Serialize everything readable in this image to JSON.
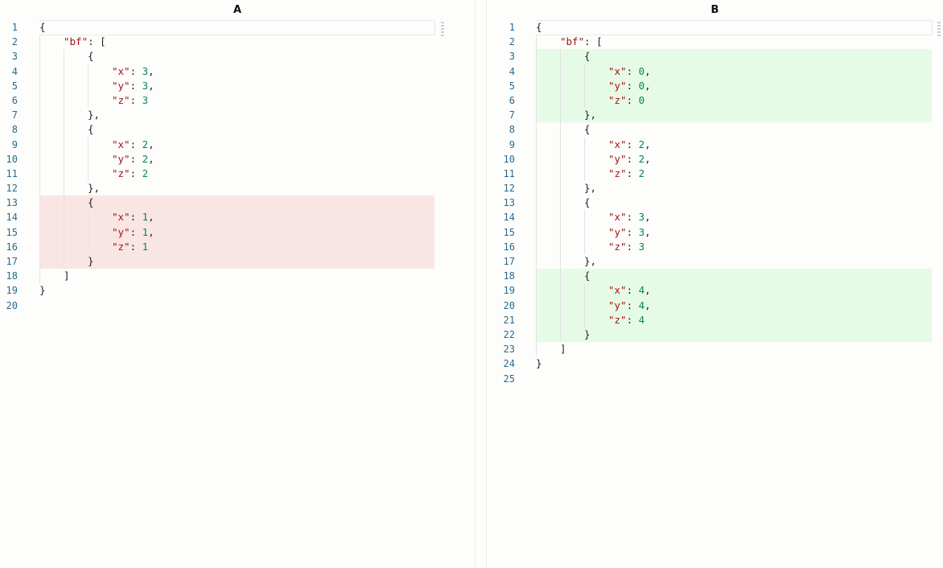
{
  "panes": [
    {
      "title": "A",
      "lines": [
        {
          "num": "1",
          "type": "normal",
          "indent": 0,
          "parts": [
            {
              "t": "{",
              "c": "p"
            }
          ]
        },
        {
          "num": "2",
          "type": "normal",
          "indent": 1,
          "parts": [
            {
              "t": "\"bf\"",
              "c": "key"
            },
            {
              "t": ": [",
              "c": "p"
            }
          ]
        },
        {
          "num": "3",
          "type": "normal",
          "indent": 2,
          "parts": [
            {
              "t": "{",
              "c": "p"
            }
          ]
        },
        {
          "num": "4",
          "type": "normal",
          "indent": 3,
          "parts": [
            {
              "t": "\"x\"",
              "c": "key"
            },
            {
              "t": ": ",
              "c": "p"
            },
            {
              "t": "3",
              "c": "num"
            },
            {
              "t": ",",
              "c": "p"
            }
          ]
        },
        {
          "num": "5",
          "type": "normal",
          "indent": 3,
          "parts": [
            {
              "t": "\"y\"",
              "c": "key"
            },
            {
              "t": ": ",
              "c": "p"
            },
            {
              "t": "3",
              "c": "num"
            },
            {
              "t": ",",
              "c": "p"
            }
          ]
        },
        {
          "num": "6",
          "type": "normal",
          "indent": 3,
          "parts": [
            {
              "t": "\"z\"",
              "c": "key"
            },
            {
              "t": ": ",
              "c": "p"
            },
            {
              "t": "3",
              "c": "num"
            }
          ]
        },
        {
          "num": "7",
          "type": "normal",
          "indent": 2,
          "parts": [
            {
              "t": "},",
              "c": "p"
            }
          ]
        },
        {
          "num": "8",
          "type": "normal",
          "indent": 2,
          "parts": [
            {
              "t": "{",
              "c": "p"
            }
          ]
        },
        {
          "num": "9",
          "type": "normal",
          "indent": 3,
          "parts": [
            {
              "t": "\"x\"",
              "c": "key"
            },
            {
              "t": ": ",
              "c": "p"
            },
            {
              "t": "2",
              "c": "num"
            },
            {
              "t": ",",
              "c": "p"
            }
          ]
        },
        {
          "num": "10",
          "type": "normal",
          "indent": 3,
          "parts": [
            {
              "t": "\"y\"",
              "c": "key"
            },
            {
              "t": ": ",
              "c": "p"
            },
            {
              "t": "2",
              "c": "num"
            },
            {
              "t": ",",
              "c": "p"
            }
          ]
        },
        {
          "num": "11",
          "type": "normal",
          "indent": 3,
          "parts": [
            {
              "t": "\"z\"",
              "c": "key"
            },
            {
              "t": ": ",
              "c": "p"
            },
            {
              "t": "2",
              "c": "num"
            }
          ]
        },
        {
          "num": "12",
          "type": "normal",
          "indent": 2,
          "parts": [
            {
              "t": "},",
              "c": "p"
            }
          ]
        },
        {
          "num": "13",
          "type": "removed",
          "indent": 2,
          "parts": [
            {
              "t": "{",
              "c": "p"
            }
          ]
        },
        {
          "num": "14",
          "type": "removed",
          "indent": 3,
          "parts": [
            {
              "t": "\"x\"",
              "c": "key"
            },
            {
              "t": ": ",
              "c": "p"
            },
            {
              "t": "1",
              "c": "num"
            },
            {
              "t": ",",
              "c": "p"
            }
          ]
        },
        {
          "num": "15",
          "type": "removed",
          "indent": 3,
          "parts": [
            {
              "t": "\"y\"",
              "c": "key"
            },
            {
              "t": ": ",
              "c": "p"
            },
            {
              "t": "1",
              "c": "num"
            },
            {
              "t": ",",
              "c": "p"
            }
          ]
        },
        {
          "num": "16",
          "type": "removed",
          "indent": 3,
          "parts": [
            {
              "t": "\"z\"",
              "c": "key"
            },
            {
              "t": ": ",
              "c": "p"
            },
            {
              "t": "1",
              "c": "num"
            }
          ]
        },
        {
          "num": "17",
          "type": "removed",
          "indent": 2,
          "parts": [
            {
              "t": "}",
              "c": "p"
            }
          ]
        },
        {
          "num": "18",
          "type": "normal",
          "indent": 1,
          "parts": [
            {
              "t": "]",
              "c": "p"
            }
          ]
        },
        {
          "num": "19",
          "type": "normal",
          "indent": 0,
          "parts": [
            {
              "t": "}",
              "c": "p"
            }
          ]
        },
        {
          "num": "20",
          "type": "normal",
          "indent": 0,
          "parts": []
        }
      ]
    },
    {
      "title": "B",
      "lines": [
        {
          "num": "1",
          "type": "normal",
          "indent": 0,
          "parts": [
            {
              "t": "{",
              "c": "p"
            }
          ]
        },
        {
          "num": "2",
          "type": "normal",
          "indent": 1,
          "parts": [
            {
              "t": "\"bf\"",
              "c": "key"
            },
            {
              "t": ": [",
              "c": "p"
            }
          ]
        },
        {
          "num": "3",
          "type": "added",
          "indent": 2,
          "parts": [
            {
              "t": "{",
              "c": "p"
            }
          ]
        },
        {
          "num": "4",
          "type": "added",
          "indent": 3,
          "parts": [
            {
              "t": "\"x\"",
              "c": "key"
            },
            {
              "t": ": ",
              "c": "p"
            },
            {
              "t": "0",
              "c": "num"
            },
            {
              "t": ",",
              "c": "p"
            }
          ]
        },
        {
          "num": "5",
          "type": "added",
          "indent": 3,
          "parts": [
            {
              "t": "\"y\"",
              "c": "key"
            },
            {
              "t": ": ",
              "c": "p"
            },
            {
              "t": "0",
              "c": "num"
            },
            {
              "t": ",",
              "c": "p"
            }
          ]
        },
        {
          "num": "6",
          "type": "added",
          "indent": 3,
          "parts": [
            {
              "t": "\"z\"",
              "c": "key"
            },
            {
              "t": ": ",
              "c": "p"
            },
            {
              "t": "0",
              "c": "num"
            }
          ]
        },
        {
          "num": "7",
          "type": "added",
          "indent": 2,
          "parts": [
            {
              "t": "},",
              "c": "p"
            }
          ]
        },
        {
          "num": "8",
          "type": "normal",
          "indent": 2,
          "parts": [
            {
              "t": "{",
              "c": "p"
            }
          ]
        },
        {
          "num": "9",
          "type": "normal",
          "indent": 3,
          "parts": [
            {
              "t": "\"x\"",
              "c": "key"
            },
            {
              "t": ": ",
              "c": "p"
            },
            {
              "t": "2",
              "c": "num"
            },
            {
              "t": ",",
              "c": "p"
            }
          ]
        },
        {
          "num": "10",
          "type": "normal",
          "indent": 3,
          "parts": [
            {
              "t": "\"y\"",
              "c": "key"
            },
            {
              "t": ": ",
              "c": "p"
            },
            {
              "t": "2",
              "c": "num"
            },
            {
              "t": ",",
              "c": "p"
            }
          ]
        },
        {
          "num": "11",
          "type": "normal",
          "indent": 3,
          "parts": [
            {
              "t": "\"z\"",
              "c": "key"
            },
            {
              "t": ": ",
              "c": "p"
            },
            {
              "t": "2",
              "c": "num"
            }
          ]
        },
        {
          "num": "12",
          "type": "normal",
          "indent": 2,
          "parts": [
            {
              "t": "},",
              "c": "p"
            }
          ]
        },
        {
          "num": "13",
          "type": "normal",
          "indent": 2,
          "parts": [
            {
              "t": "{",
              "c": "p"
            }
          ]
        },
        {
          "num": "14",
          "type": "normal",
          "indent": 3,
          "parts": [
            {
              "t": "\"x\"",
              "c": "key"
            },
            {
              "t": ": ",
              "c": "p"
            },
            {
              "t": "3",
              "c": "num"
            },
            {
              "t": ",",
              "c": "p"
            }
          ]
        },
        {
          "num": "15",
          "type": "normal",
          "indent": 3,
          "parts": [
            {
              "t": "\"y\"",
              "c": "key"
            },
            {
              "t": ": ",
              "c": "p"
            },
            {
              "t": "3",
              "c": "num"
            },
            {
              "t": ",",
              "c": "p"
            }
          ]
        },
        {
          "num": "16",
          "type": "normal",
          "indent": 3,
          "parts": [
            {
              "t": "\"z\"",
              "c": "key"
            },
            {
              "t": ": ",
              "c": "p"
            },
            {
              "t": "3",
              "c": "num"
            }
          ]
        },
        {
          "num": "17",
          "type": "normal",
          "indent": 2,
          "parts": [
            {
              "t": "},",
              "c": "p"
            }
          ]
        },
        {
          "num": "18",
          "type": "added",
          "indent": 2,
          "parts": [
            {
              "t": "{",
              "c": "p"
            }
          ]
        },
        {
          "num": "19",
          "type": "added",
          "indent": 3,
          "parts": [
            {
              "t": "\"x\"",
              "c": "key"
            },
            {
              "t": ": ",
              "c": "p"
            },
            {
              "t": "4",
              "c": "num"
            },
            {
              "t": ",",
              "c": "p"
            }
          ]
        },
        {
          "num": "20",
          "type": "added",
          "indent": 3,
          "parts": [
            {
              "t": "\"y\"",
              "c": "key"
            },
            {
              "t": ": ",
              "c": "p"
            },
            {
              "t": "4",
              "c": "num"
            },
            {
              "t": ",",
              "c": "p"
            }
          ]
        },
        {
          "num": "21",
          "type": "added",
          "indent": 3,
          "parts": [
            {
              "t": "\"z\"",
              "c": "key"
            },
            {
              "t": ": ",
              "c": "p"
            },
            {
              "t": "4",
              "c": "num"
            }
          ]
        },
        {
          "num": "22",
          "type": "added",
          "indent": 2,
          "parts": [
            {
              "t": "}",
              "c": "p"
            }
          ]
        },
        {
          "num": "23",
          "type": "normal",
          "indent": 1,
          "parts": [
            {
              "t": "]",
              "c": "p"
            }
          ]
        },
        {
          "num": "24",
          "type": "normal",
          "indent": 0,
          "parts": [
            {
              "t": "}",
              "c": "p"
            }
          ]
        },
        {
          "num": "25",
          "type": "normal",
          "indent": 0,
          "parts": []
        }
      ]
    }
  ],
  "colors": {
    "removed_bg": "#f9e6e4",
    "added_bg": "#e6fbe6",
    "key": "#a31515",
    "number": "#098658",
    "line_number": "#2a6a8e"
  }
}
